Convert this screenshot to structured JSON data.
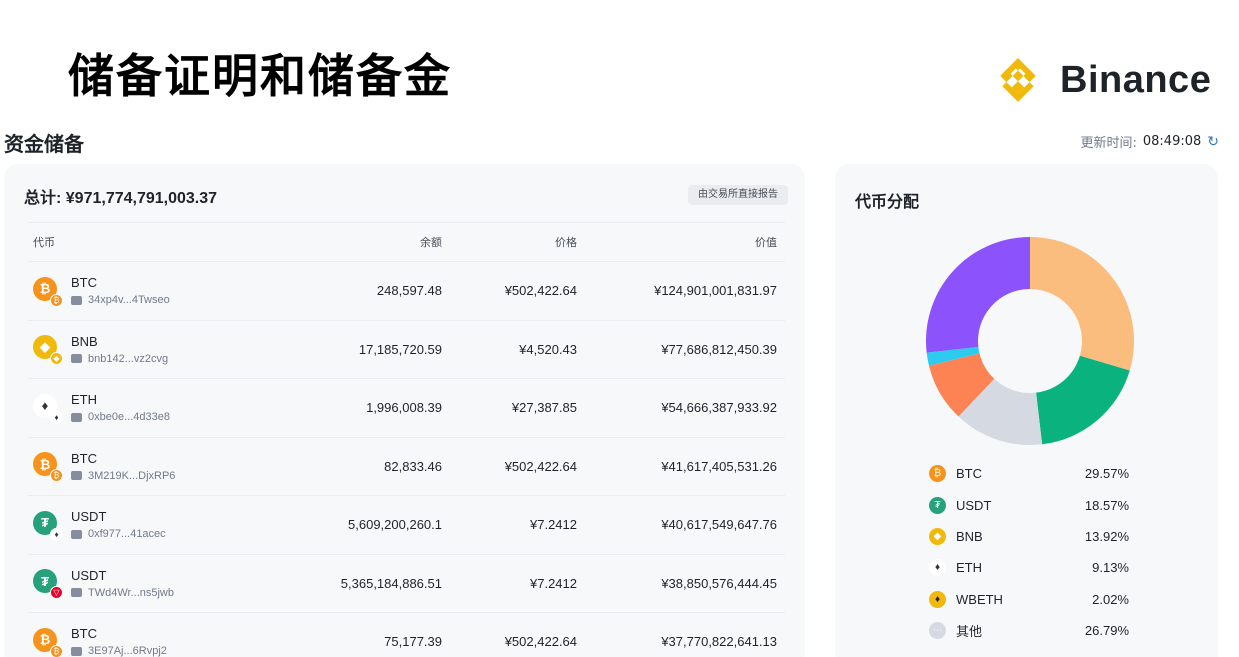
{
  "slide_title": "储备证明和储备金",
  "brand": {
    "name": "Binance",
    "color": "#f0b90b"
  },
  "section_title": "资金储备",
  "update": {
    "label": "更新时间:",
    "time": "08:49:08",
    "icon": "refresh-icon"
  },
  "total": "总计: ¥971,774,791,003.37",
  "report_badge": "由交易所直接报告",
  "table": {
    "headers": {
      "coin": "代币",
      "balance": "余额",
      "price": "价格",
      "value": "价值"
    },
    "rows": [
      {
        "symbol": "BTC",
        "address": "34xp4v...4Twseo",
        "balance": "248,597.48",
        "price": "¥502,422.64",
        "value": "¥124,901,001,831.97",
        "icon": "btc-icon",
        "chain_icon": "btc-chain-icon"
      },
      {
        "symbol": "BNB",
        "address": "bnb142...vz2cvg",
        "balance": "17,185,720.59",
        "price": "¥4,520.43",
        "value": "¥77,686,812,450.39",
        "icon": "bnb-icon",
        "chain_icon": "bnb-chain-icon"
      },
      {
        "symbol": "ETH",
        "address": "0xbe0e...4d33e8",
        "balance": "1,996,008.39",
        "price": "¥27,387.85",
        "value": "¥54,666,387,933.92",
        "icon": "eth-icon",
        "chain_icon": "eth-chain-icon"
      },
      {
        "symbol": "BTC",
        "address": "3M219K...DjxRP6",
        "balance": "82,833.46",
        "price": "¥502,422.64",
        "value": "¥41,617,405,531.26",
        "icon": "btc-icon",
        "chain_icon": "btc-chain-icon"
      },
      {
        "symbol": "USDT",
        "address": "0xf977...41acec",
        "balance": "5,609,200,260.1",
        "price": "¥7.2412",
        "value": "¥40,617,549,647.76",
        "icon": "usdt-icon",
        "chain_icon": "eth-chain-icon"
      },
      {
        "symbol": "USDT",
        "address": "TWd4Wr...ns5jwb",
        "balance": "5,365,184,886.51",
        "price": "¥7.2412",
        "value": "¥38,850,576,444.45",
        "icon": "usdt-icon",
        "chain_icon": "tron-chain-icon"
      },
      {
        "symbol": "BTC",
        "address": "3E97Aj...6Rvpj2",
        "balance": "75,177.39",
        "price": "¥502,422.64",
        "value": "¥37,770,822,641.13",
        "icon": "btc-icon",
        "chain_icon": "btc-chain-icon"
      }
    ]
  },
  "distribution": {
    "title": "代币分配",
    "items": [
      {
        "name": "BTC",
        "pct": "29.57%",
        "color": "#fbbd7d",
        "icon": "btc-icon"
      },
      {
        "name": "USDT",
        "pct": "18.57%",
        "color": "#0ab27d",
        "icon": "usdt-icon"
      },
      {
        "name": "BNB",
        "pct": "13.92%",
        "color": "#d5d9e2",
        "icon": "bnb-icon"
      },
      {
        "name": "ETH",
        "pct": "9.13%",
        "color": "#fd8355",
        "icon": "eth-icon"
      },
      {
        "name": "WBETH",
        "pct": "2.02%",
        "color": "#2dcbf0",
        "icon": "wbeth-icon"
      },
      {
        "name": "其他",
        "pct": "26.79%",
        "color": "#8c53fc",
        "icon": "other-icon"
      }
    ]
  },
  "chart_data": {
    "type": "pie",
    "title": "代币分配",
    "categories": [
      "BTC",
      "USDT",
      "BNB",
      "ETH",
      "WBETH",
      "其他"
    ],
    "values": [
      29.57,
      18.57,
      13.92,
      9.13,
      2.02,
      26.79
    ],
    "colors": [
      "#fbbd7d",
      "#0ab27d",
      "#d5d9e2",
      "#fd8355",
      "#2dcbf0",
      "#8c53fc"
    ],
    "legend": "bottom"
  }
}
